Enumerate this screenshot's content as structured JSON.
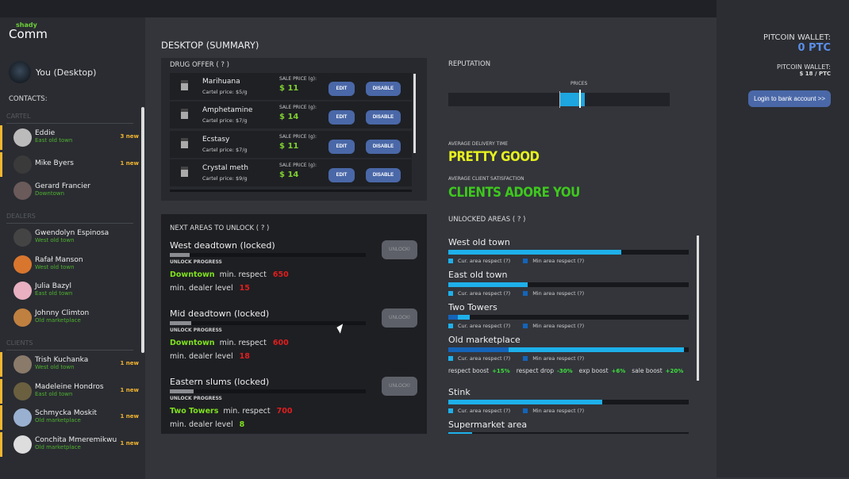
{
  "app": {
    "logo_small": "shady",
    "logo_big": "Comm",
    "user": "You (Desktop)",
    "contacts_label": "CONTACTS:"
  },
  "sections": {
    "cartel": "CARTEL",
    "dealers": "DEALERS",
    "clients": "CLIENTS"
  },
  "contacts": [
    {
      "name": "Eddie",
      "loc": "East old town",
      "new": "3 new"
    },
    {
      "name": "Mike Byers",
      "loc": "",
      "new": "1 new"
    },
    {
      "name": "Gerard Francier",
      "loc": "Downtown",
      "new": ""
    },
    {
      "name": "Gwendolyn Espinosa",
      "loc": "West old town",
      "new": ""
    },
    {
      "name": "Rafał Manson",
      "loc": "West old town",
      "new": ""
    },
    {
      "name": "Julia Bazyl",
      "loc": "East old town",
      "new": ""
    },
    {
      "name": "Johnny Climton",
      "loc": "Old marketplace",
      "new": ""
    },
    {
      "name": "Trish Kuchanka",
      "loc": "West old town",
      "new": "1 new"
    },
    {
      "name": "Madeleine Hondros",
      "loc": "East old town",
      "new": "1 new"
    },
    {
      "name": "Schmycka Moskit",
      "loc": "Old marketplace",
      "new": "1 new"
    },
    {
      "name": "Conchita Mmeremikwu",
      "loc": "Old marketplace",
      "new": "1 new"
    }
  ],
  "page_title": "DESKTOP (SUMMARY)",
  "drug_offer": {
    "title": "DRUG OFFER ( ? )",
    "sale_label": "SALE PRICE (g):",
    "edit": "EDIT",
    "disable": "DISABLE",
    "items": [
      {
        "name": "Marihuana",
        "cartel": "Cartel price: $5/g",
        "price": "$ 11"
      },
      {
        "name": "Amphetamine",
        "cartel": "Cartel price: $7/g",
        "price": "$ 14"
      },
      {
        "name": "Ecstasy",
        "cartel": "Cartel price: $7/g",
        "price": "$ 11"
      },
      {
        "name": "Crystal meth",
        "cartel": "Cartel price: $9/g",
        "price": "$ 14"
      }
    ]
  },
  "next_areas": {
    "title": "NEXT AREAS TO UNLOCK ( ? )",
    "progress_label": "UNLOCK PROGRESS",
    "unlock": "UNLOCK!",
    "min_respect": "min. respect",
    "min_level": "min. dealer level",
    "items": [
      {
        "name": "West deadtown (locked)",
        "progress": 0.1,
        "area": "Downtown",
        "respect": "650",
        "level": "15",
        "level_ok": false
      },
      {
        "name": "Mid deadtown (locked)",
        "progress": 0.11,
        "area": "Downtown",
        "respect": "600",
        "level": "18",
        "level_ok": false
      },
      {
        "name": "Eastern slums (locked)",
        "progress": 0.12,
        "area": "Two Towers",
        "respect": "700",
        "level": "8",
        "level_ok": true
      }
    ]
  },
  "reputation": {
    "title": "REPUTATION",
    "marker_label": "PRICES",
    "range": [
      0.5,
      0.615
    ],
    "marker": 0.59
  },
  "delivery": {
    "label": "AVERAGE DELIVERY TIME",
    "value": "PRETTY GOOD",
    "color": "#e6f01e"
  },
  "satisfaction": {
    "label": "AVERAGE CLIENT SATISFACTION",
    "value": "CLIENTS ADORE YOU",
    "color": "#3ec81e"
  },
  "unlocked": {
    "title": "UNLOCKED AREAS ( ? )",
    "cur_label": "Cur. area respect (?)",
    "min_label": "Min area respect (?)",
    "items": [
      {
        "name": "West old town",
        "cur": 0.72,
        "min": 0
      },
      {
        "name": "East old town",
        "cur": 0.33,
        "min": 0
      },
      {
        "name": "Two Towers",
        "cur": 0.09,
        "min": 0.04
      },
      {
        "name": "Old marketplace",
        "cur": 0.98,
        "min": 0.25,
        "boosts": [
          {
            "label": "respect boost",
            "value": "+15%"
          },
          {
            "label": "respect drop",
            "value": "-30%"
          },
          {
            "label": "exp boost",
            "value": "+6%"
          },
          {
            "label": "sale boost",
            "value": "+20%"
          }
        ]
      },
      {
        "name": "Stink",
        "cur": 0.64,
        "min": 0
      },
      {
        "name": "Supermarket area",
        "cur": 0.1,
        "min": 0
      }
    ]
  },
  "wallet": {
    "label": "PITCOIN WALLET:",
    "value": "0 PTC",
    "rate_label": "PITCOIN WALLET:",
    "rate": "$ 18 / PTC",
    "login": "Login to bank account >>"
  },
  "colors": {
    "accent": "#4a68a8",
    "new_badge": "#f2b632",
    "location": "#4fb030",
    "bar_cur": "#1eb0ea",
    "bar_min": "#1464b8"
  }
}
